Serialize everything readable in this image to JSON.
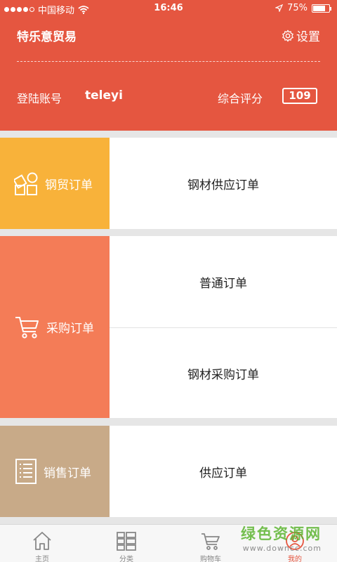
{
  "status_bar": {
    "carrier": "中国移动",
    "time": "16:46",
    "battery_percent": "75%",
    "battery_level": 0.75
  },
  "header": {
    "app_name": "特乐意贸易",
    "settings_label": "设置",
    "account_label": "登陆账号",
    "account_value": "teleyi",
    "score_label": "综合评分",
    "score_value": "109"
  },
  "sections": {
    "steel_trade": {
      "label": "钢贸订单",
      "color": "#f8b23a",
      "items": [
        "钢材供应订单"
      ]
    },
    "purchase": {
      "label": "采购订单",
      "color": "#f47c57",
      "items": [
        "普通订单",
        "钢材采购订单"
      ]
    },
    "sales": {
      "label": "销售订单",
      "color": "#c8aa88",
      "items": [
        "供应订单"
      ]
    }
  },
  "tabbar": {
    "tabs": [
      {
        "label": "主页",
        "icon": "home-icon"
      },
      {
        "label": "分类",
        "icon": "category-icon"
      },
      {
        "label": "购物车",
        "icon": "cart-icon"
      },
      {
        "label": "我的",
        "icon": "profile-icon"
      }
    ],
    "active_index": 3
  },
  "watermark": {
    "title": "绿色资源网",
    "url": "www.downcc.com"
  },
  "colors": {
    "brand": "#e55640",
    "tab_inactive": "#888888"
  }
}
